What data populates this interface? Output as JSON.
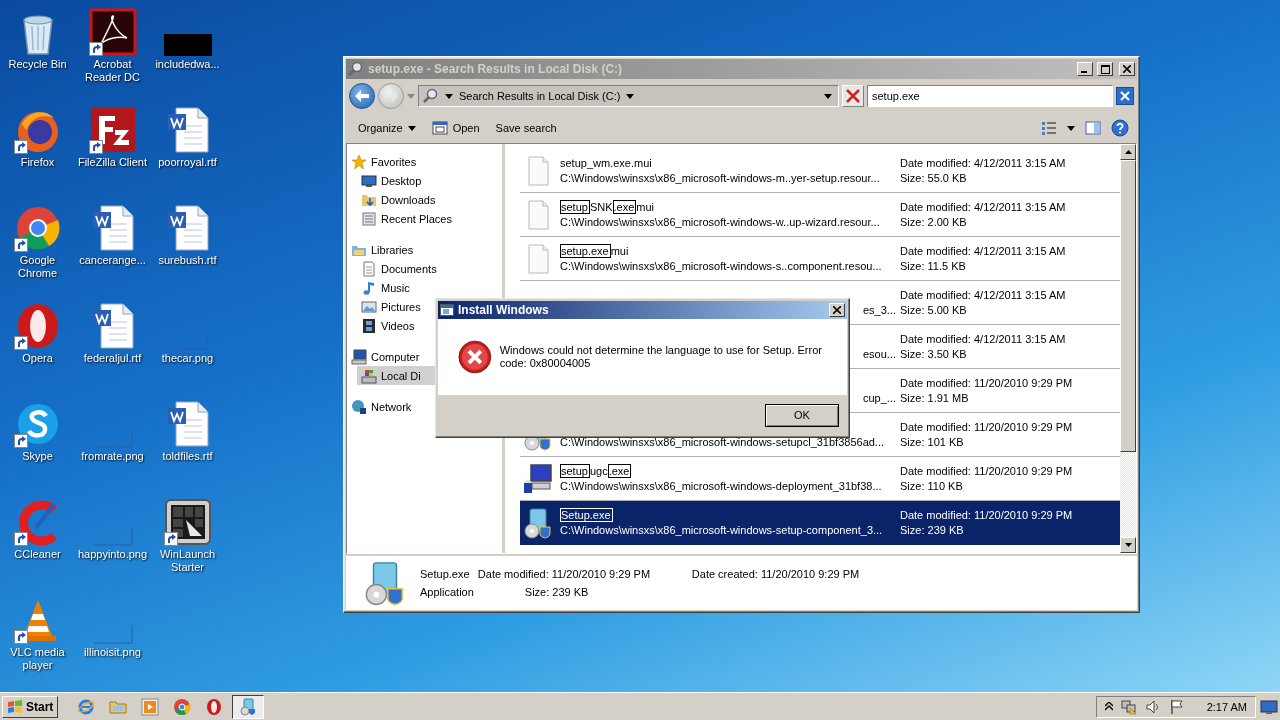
{
  "desktop_icons": [
    {
      "label": "Recycle Bin",
      "kind": "recycle",
      "shortcut": false
    },
    {
      "label": "Firefox",
      "kind": "firefox",
      "shortcut": true
    },
    {
      "label": "Google Chrome",
      "kind": "chrome",
      "shortcut": true
    },
    {
      "label": "Opera",
      "kind": "opera",
      "shortcut": true
    },
    {
      "label": "Skype",
      "kind": "skype",
      "shortcut": true
    },
    {
      "label": "CCleaner",
      "kind": "ccleaner",
      "shortcut": true
    },
    {
      "label": "VLC media player",
      "kind": "vlc",
      "shortcut": true
    },
    {
      "label": "Acrobat Reader DC",
      "kind": "acrobat",
      "shortcut": true
    },
    {
      "label": "FileZilla Client",
      "kind": "filezilla",
      "shortcut": true
    },
    {
      "label": "cancerange...",
      "kind": "word",
      "shortcut": false
    },
    {
      "label": "federaljul.rtf",
      "kind": "word",
      "shortcut": false
    },
    {
      "label": "fromrate.png",
      "kind": "blank",
      "shortcut": false
    },
    {
      "label": "happyinto.png",
      "kind": "blank",
      "shortcut": false
    },
    {
      "label": "illinoisit.png",
      "kind": "blank",
      "shortcut": false
    },
    {
      "label": "includedwa...",
      "kind": "dark",
      "shortcut": false
    },
    {
      "label": "poorroyal.rtf",
      "kind": "word",
      "shortcut": false
    },
    {
      "label": "surebush.rtf",
      "kind": "word",
      "shortcut": false
    },
    {
      "label": "thecar.png",
      "kind": "blank",
      "shortcut": false
    },
    {
      "label": "toldfiles.rtf",
      "kind": "word",
      "shortcut": false
    },
    {
      "label": "WinLaunch Starter",
      "kind": "winlaunch",
      "shortcut": true
    }
  ],
  "explorer": {
    "title": "setup.exe - Search Results in Local Disk (C:)",
    "address": "Search Results in Local Disk (C:)",
    "search_value": "setup.exe",
    "toolbar": [
      {
        "label": "Organize",
        "kind": "menu"
      },
      {
        "label": "Open",
        "kind": "icon"
      },
      {
        "label": "Save search",
        "kind": "plain"
      }
    ],
    "nav": [
      {
        "label": "Favorites",
        "kind": "star",
        "selected": false,
        "children": [
          {
            "label": "Desktop",
            "kind": "desktop",
            "selected": false
          },
          {
            "label": "Downloads",
            "kind": "downloads",
            "selected": false
          },
          {
            "label": "Recent Places",
            "kind": "recent",
            "selected": false
          }
        ]
      },
      {
        "label": "Libraries",
        "kind": "library",
        "selected": false,
        "children": [
          {
            "label": "Documents",
            "kind": "documents",
            "selected": false
          },
          {
            "label": "Music",
            "kind": "music",
            "selected": false
          },
          {
            "label": "Pictures",
            "kind": "pictures",
            "selected": false
          },
          {
            "label": "Videos",
            "kind": "videos",
            "selected": false
          }
        ]
      },
      {
        "label": "Computer",
        "kind": "computer",
        "selected": false,
        "children": [
          {
            "label": "Local Di",
            "kind": "disk",
            "selected": true
          }
        ]
      },
      {
        "label": "Network",
        "kind": "network",
        "selected": false
      }
    ],
    "rows": [
      {
        "kind": "blank",
        "selected": false,
        "name": [
          {
            "text": "setup_wm.exe.mui",
            "match": false
          }
        ],
        "path": "C:\\Windows\\winsxs\\x86_microsoft-windows-m..yer-setup.resour...",
        "date": "Date modified: 4/12/2011 3:15 AM",
        "size": "Size: 55.0 KB"
      },
      {
        "kind": "blank",
        "selected": false,
        "name": [
          {
            "text": "setup",
            "match": true
          },
          {
            "text": "SNK",
            "match": false
          },
          {
            "text": ".exe",
            "match": true
          },
          {
            "text": "mui",
            "match": false
          }
        ],
        "path": "C:\\Windows\\winsxs\\x86_microsoft-windows-w..up-wizard.resour...",
        "date": "Date modified: 4/12/2011 3:15 AM",
        "size": "Size: 2.00 KB"
      },
      {
        "kind": "blank",
        "selected": false,
        "name": [
          {
            "text": "setup.exe",
            "match": true
          },
          {
            "text": "mui",
            "match": false
          }
        ],
        "path": "C:\\Windows\\winsxs\\x86_microsoft-windows-s..component.resou...",
        "date": "Date modified: 4/12/2011 3:15 AM",
        "size": "Size: 11.5 KB"
      },
      {
        "kind": "covered",
        "selected": false,
        "path": "es_3...",
        "date": "Date modified: 4/12/2011 3:15 AM",
        "size": "Size: 5.00 KB"
      },
      {
        "kind": "covered",
        "selected": false,
        "path": "esou...",
        "date": "Date modified: 4/12/2011 3:15 AM",
        "size": "Size: 3.50 KB"
      },
      {
        "kind": "covered",
        "selected": false,
        "path": "cup_...",
        "date": "Date modified: 11/20/2010 9:29 PM",
        "size": "Size: 1.91 MB"
      },
      {
        "kind": "setup",
        "selected": false,
        "path": "C:\\Windows\\winsxs\\x86_microsoft-windows-setupcl_31bf3856ad...",
        "date": "Date modified: 11/20/2010 9:29 PM",
        "size": "Size: 101 KB"
      },
      {
        "kind": "computer",
        "selected": false,
        "name": [
          {
            "text": "setup",
            "match": true
          },
          {
            "text": "ugc",
            "match": false
          },
          {
            "text": ".exe",
            "match": true
          }
        ],
        "path": "C:\\Windows\\winsxs\\x86_microsoft-windows-deployment_31bf38...",
        "date": "Date modified: 11/20/2010 9:29 PM",
        "size": "Size: 110 KB"
      },
      {
        "kind": "setup",
        "selected": true,
        "name": [
          {
            "text": "Setup.exe",
            "match": true
          }
        ],
        "path": "C:\\Windows\\winsxs\\x86_microsoft-windows-setup-component_3...",
        "date": "Date modified: 11/20/2010 9:29 PM",
        "size": "Size: 239 KB"
      }
    ],
    "details": {
      "name": "Setup.exe",
      "type": "Application",
      "modified": "Date modified: 11/20/2010 9:29 PM",
      "size": "Size: 239 KB",
      "created": "Date created: 11/20/2010 9:29 PM"
    }
  },
  "dialog": {
    "title": "Install Windows",
    "message": "Windows could not determine the language to use for Setup. Error code: 0x80004005",
    "button": "OK"
  },
  "taskbar": {
    "start": "Start",
    "apps": [
      {
        "kind": "ie",
        "selected": false
      },
      {
        "kind": "folder",
        "selected": false
      },
      {
        "kind": "media",
        "selected": false
      },
      {
        "kind": "chrome",
        "selected": false
      },
      {
        "kind": "opera",
        "selected": false
      },
      {
        "kind": "setup",
        "selected": true
      }
    ],
    "time": "2:17 AM"
  }
}
